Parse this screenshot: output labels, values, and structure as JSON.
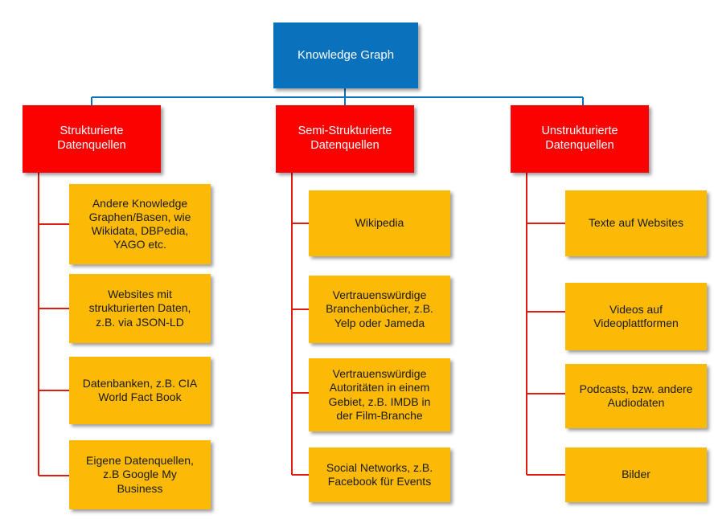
{
  "diagram": {
    "title_node": {
      "label": "Knowledge Graph",
      "color": "#0A72BD",
      "text_color": "#FFFFFF"
    },
    "palette": {
      "root": "#0A72BD",
      "category": "#FB0100",
      "leaf": "#FCBA06",
      "connector_root": "#0A72BD",
      "connector_branch": "#E01B10",
      "background": "#FFFFFF"
    },
    "categories": [
      {
        "label": "Strukturierte\nDatenquellen",
        "children": [
          {
            "label": "Andere Knowledge\nGraphen/Basen, wie\nWikidata, DBPedia,\nYAGO etc."
          },
          {
            "label": "Websites mit\nstrukturierten Daten,\nz.B. via JSON-LD"
          },
          {
            "label": "Datenbanken, z.B. CIA\nWorld Fact Book"
          },
          {
            "label": "Eigene Datenquellen,\nz.B Google My\nBusiness"
          }
        ]
      },
      {
        "label": "Semi-Strukturierte\nDatenquellen",
        "children": [
          {
            "label": "Wikipedia"
          },
          {
            "label": "Vertrauenswürdige\nBranchenbücher,  z.B.\nYelp oder Jameda"
          },
          {
            "label": "Vertrauenswürdige\nAutoritäten in einem\nGebiet, z.B. IMDB in\nder Film-Branche"
          },
          {
            "label": "Social Networks, z.B.\nFacebook für Events"
          }
        ]
      },
      {
        "label": "Unstrukturierte\nDatenquellen",
        "children": [
          {
            "label": "Texte auf Websites"
          },
          {
            "label": "Videos auf\nVideoplattformen"
          },
          {
            "label": "Podcasts, bzw. andere\nAudiodaten"
          },
          {
            "label": "Bilder"
          }
        ]
      }
    ]
  }
}
